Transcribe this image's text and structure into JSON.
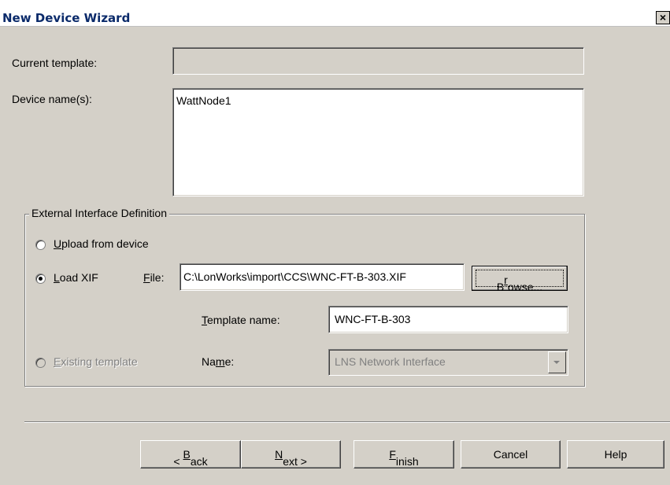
{
  "window": {
    "title": "New Device Wizard",
    "close_glyph": "×"
  },
  "current_template": {
    "label": "Current template:",
    "value": ""
  },
  "device_names": {
    "label": "Device name(s):",
    "value": "WattNode1"
  },
  "xif_group": {
    "title": "External Interface Definition",
    "upload_option": {
      "mnemonic": "U",
      "rest": "pload from device",
      "selected": false
    },
    "load_xif_option": {
      "mnemonic": "L",
      "rest": "oad XIF",
      "selected": true
    },
    "file_label": {
      "mnemonic": "F",
      "rest": "ile:"
    },
    "file_value": "C:\\LonWorks\\import\\CCS\\WNC-FT-B-303.XIF",
    "browse_button": {
      "pre": "B",
      "mnemonic": "r",
      "rest": "owse..."
    },
    "template_name_label": {
      "mnemonic": "T",
      "rest": "emplate name:"
    },
    "template_name_value": "WNC-FT-B-303",
    "existing_option": {
      "mnemonic": "E",
      "rest": "xisting template",
      "selected": false,
      "enabled": false
    },
    "name_label": {
      "pre": "Na",
      "mnemonic": "m",
      "rest": "e:"
    },
    "name_value": "LNS Network Interface"
  },
  "buttons": {
    "back": {
      "pre": "< ",
      "mnemonic": "B",
      "rest": "ack"
    },
    "next": {
      "pre": "",
      "mnemonic": "N",
      "rest": "ext >"
    },
    "finish": {
      "pre": "",
      "mnemonic": "F",
      "rest": "inish"
    },
    "cancel": "Cancel",
    "help": "Help"
  },
  "icons": {
    "close": "close-icon",
    "dropdown": "chevron-down-icon"
  }
}
